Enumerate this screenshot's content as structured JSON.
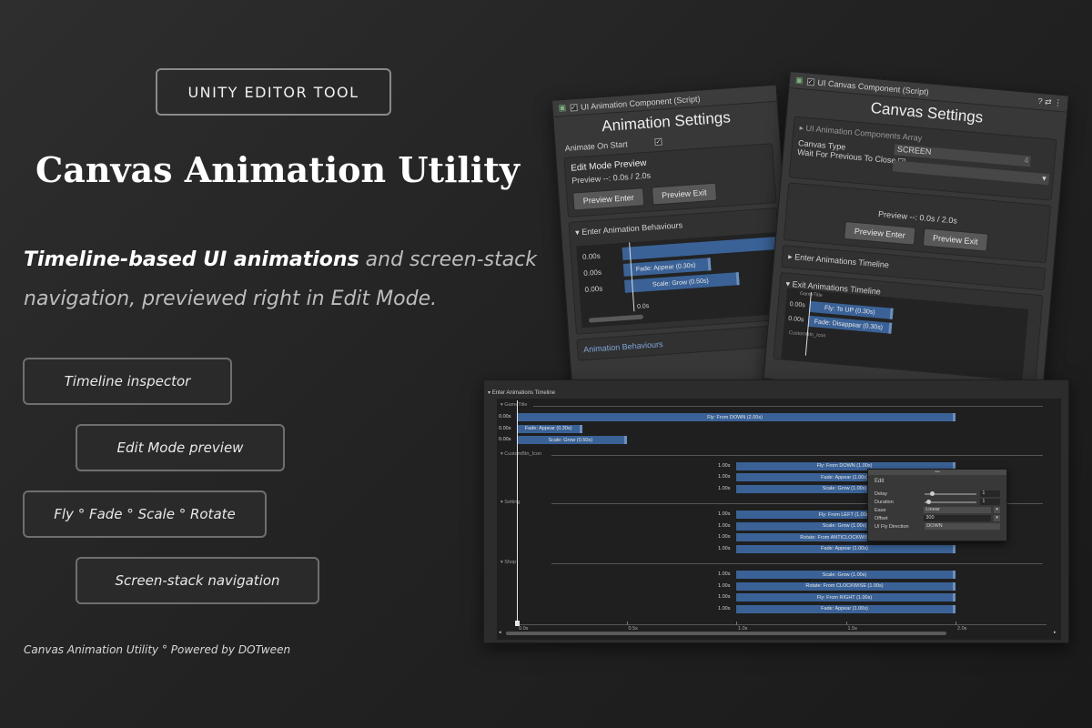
{
  "badge": "UNITY EDITOR TOOL",
  "title": "Canvas Animation Utility",
  "tagline": {
    "bold": "Timeline-based UI animations",
    "rest": " and screen-stack navigation, previewed right in Edit Mode."
  },
  "features": [
    "Timeline inspector",
    "Edit Mode preview",
    "Fly ° Fade ° Scale ° Rotate",
    "Screen-stack navigation"
  ],
  "footer": "Canvas Animation Utility ° Powered by DOTween",
  "anim_panel": {
    "header": "UI Animation Component (Script)",
    "title": "Animation Settings",
    "animate_on_start": "Animate On Start",
    "edit_mode_preview": "Edit Mode Preview",
    "preview_text": "Preview --: 0.0s / 2.0s",
    "preview_enter": "Preview Enter",
    "preview_exit": "Preview Exit",
    "enter_behaviours": "Enter Animation Behaviours",
    "rows": [
      {
        "time": "0.00s",
        "label": ""
      },
      {
        "time": "0.00s",
        "label": "Fade: Appear (0.30s)"
      },
      {
        "time": "0.00s",
        "label": "Scale: Grow (0.50s)"
      }
    ],
    "scrub_time": "0.0s",
    "exit_behaviours": "Animation Behaviours"
  },
  "canvas_panel": {
    "header": "UI Canvas Component (Script)",
    "title": "Canvas Settings",
    "components_array": "UI Animation Components Array",
    "canvas_type": "Canvas Type",
    "canvas_type_value": "SCREEN",
    "wait_previous": "Wait For Previous To Close",
    "count": "4",
    "preview_text": "Preview --: 0.0s / 2.0s",
    "preview_enter": "Preview Enter",
    "preview_exit": "Preview Exit",
    "enter_timeline": "Enter Animations Timeline",
    "exit_timeline": "Exit Animations Timeline",
    "group_game_title": "GameTitle",
    "rows": [
      {
        "time": "0.00s",
        "label": "Fly: To UP (0.30s)"
      },
      {
        "time": "0.00s",
        "label": "Fade: Disappear (0.30s)"
      }
    ],
    "group_custom": "CustomBtn_Icon"
  },
  "timeline": {
    "header": "Enter Animations Timeline",
    "groups": [
      {
        "name": "GameTitle",
        "rows": [
          {
            "time": "0.00s",
            "label": "Fly: From DOWN (2.00s)",
            "start": 0.0,
            "dur": 2.0
          },
          {
            "time": "0.00s",
            "label": "Fade: Appear (0.30s)",
            "start": 0.0,
            "dur": 0.3
          },
          {
            "time": "0.00s",
            "label": "Scale: Grow (0.50s)",
            "start": 0.0,
            "dur": 0.5
          }
        ]
      },
      {
        "name": "CustomBtn_Icon",
        "rows": [
          {
            "time": "1.00s",
            "label": "Fly: From DOWN (1.00s)",
            "start": 1.0,
            "dur": 1.0
          },
          {
            "time": "1.00s",
            "label": "Fade: Appear (1.00s)",
            "start": 1.0,
            "dur": 1.0
          },
          {
            "time": "1.00s",
            "label": "Scale: Grow (1.00s)",
            "start": 1.0,
            "dur": 1.0
          }
        ]
      },
      {
        "name": "Setting",
        "rows": [
          {
            "time": "1.00s",
            "label": "Fly: From LEFT (1.00s)",
            "start": 1.0,
            "dur": 1.0
          },
          {
            "time": "1.00s",
            "label": "Scale: Grow (1.00s)",
            "start": 1.0,
            "dur": 1.0
          },
          {
            "time": "1.00s",
            "label": "Rotate: From ANTICLOCKWISE (1.00s)",
            "start": 1.0,
            "dur": 1.0
          },
          {
            "time": "1.00s",
            "label": "Fade: Appear (1.00s)",
            "start": 1.0,
            "dur": 1.0
          }
        ]
      },
      {
        "name": "Shop",
        "rows": [
          {
            "time": "1.00s",
            "label": "Scale: Grow (1.00s)",
            "start": 1.0,
            "dur": 1.0
          },
          {
            "time": "1.00s",
            "label": "Rotate: From CLOCKWISE (1.00s)",
            "start": 1.0,
            "dur": 1.0
          },
          {
            "time": "1.00s",
            "label": "Fly: From RIGHT (1.00s)",
            "start": 1.0,
            "dur": 1.0
          },
          {
            "time": "1.00s",
            "label": "Fade: Appear (1.00s)",
            "start": 1.0,
            "dur": 1.0
          }
        ]
      }
    ],
    "ticks": [
      "0.0s",
      "0.5s",
      "1.0s",
      "1.5s",
      "2.0s"
    ],
    "edit_popup": {
      "title": "Edit",
      "delay_label": "Delay",
      "delay_value": "1",
      "duration_label": "Duration",
      "duration_value": "1",
      "ease_label": "Ease",
      "ease_value": "Linear",
      "offset_label": "Offset",
      "offset_value": "300",
      "direction_label": "UI Fly Direction",
      "direction_value": "DOWN"
    }
  }
}
